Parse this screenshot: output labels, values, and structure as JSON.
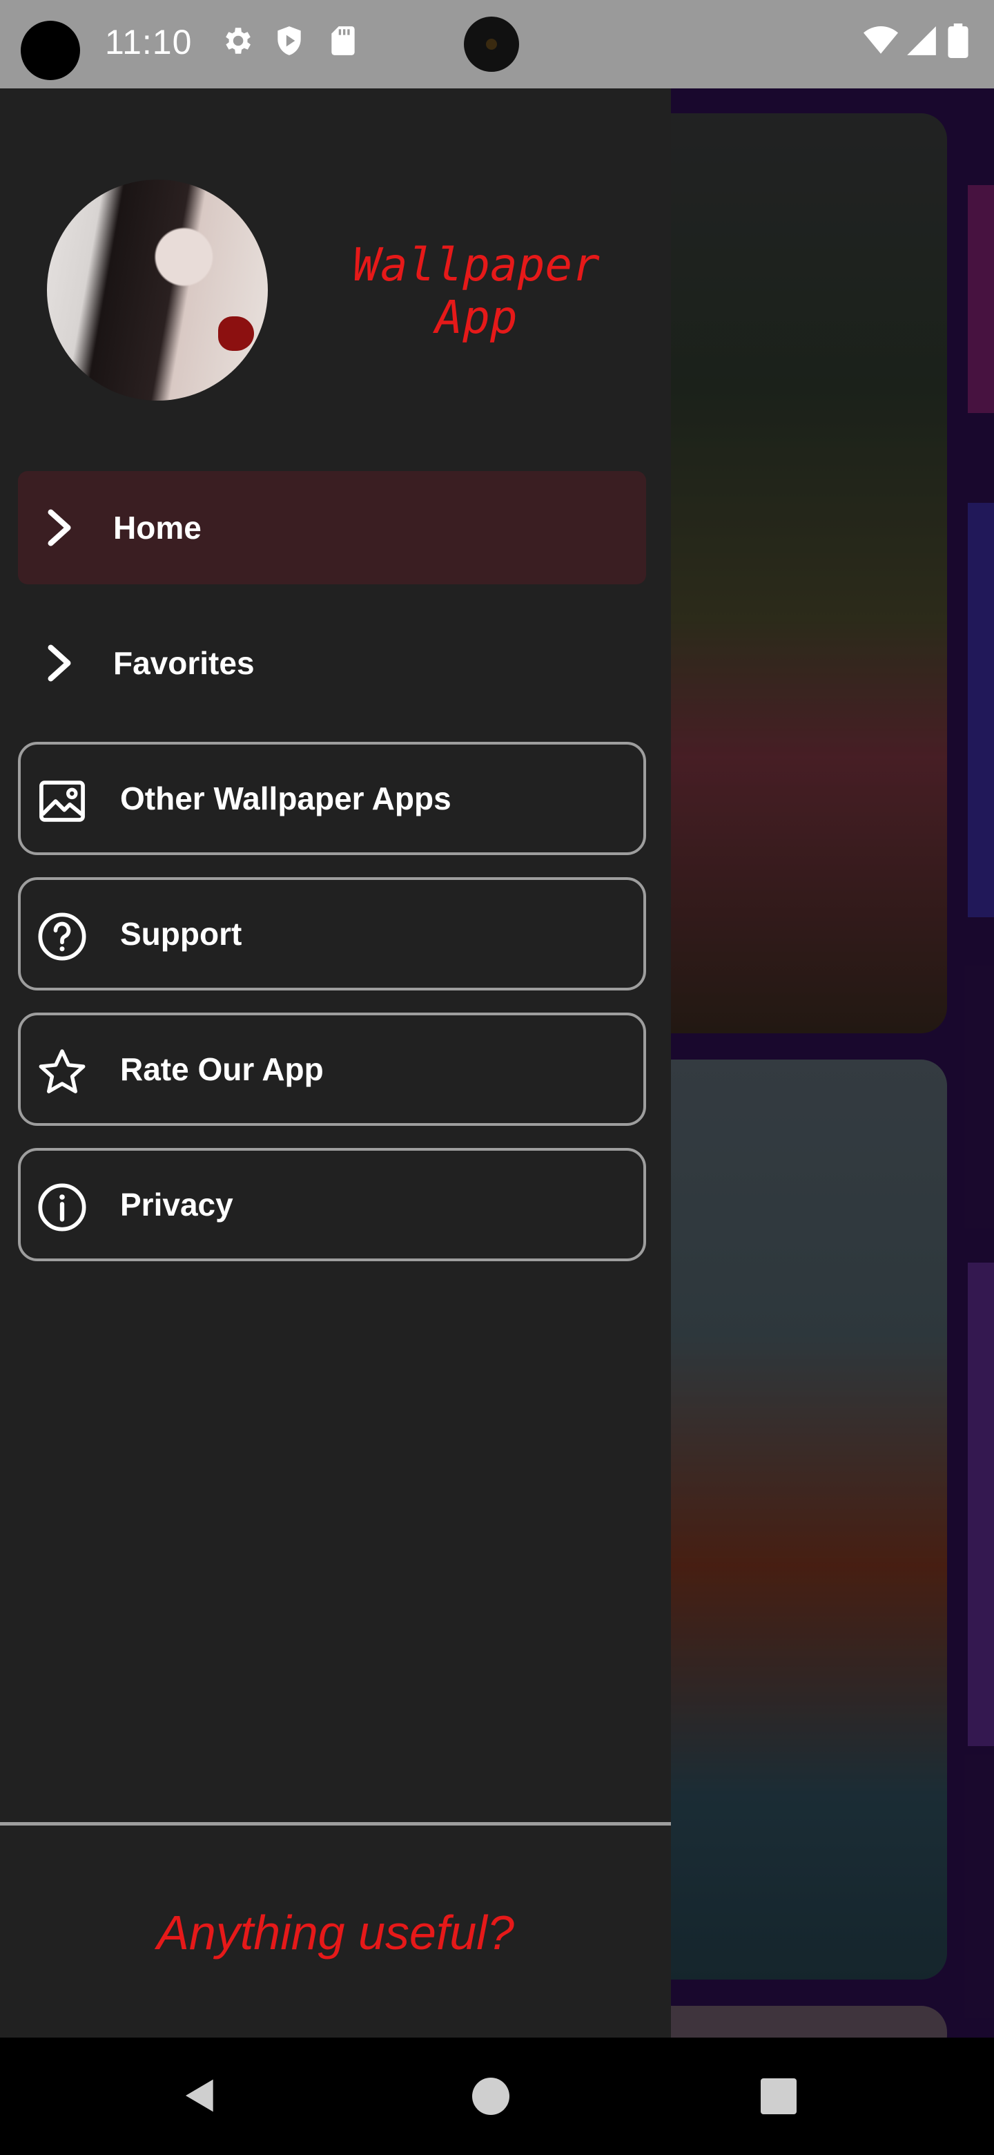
{
  "status_bar": {
    "time": "11:10",
    "icons": [
      "camera-hole",
      "gear-icon",
      "shield-icon",
      "sd-card-icon",
      "front-camera",
      "wifi-icon",
      "signal-icon",
      "battery-icon"
    ]
  },
  "drawer": {
    "app_title": "Wallpaper App",
    "menu": {
      "home_label": "Home",
      "favorites_label": "Favorites",
      "other_apps_label": "Other Wallpaper Apps",
      "support_label": "Support",
      "rate_label": "Rate Our App",
      "privacy_label": "Privacy"
    },
    "footer_text": "Anything useful?"
  },
  "colors": {
    "drawer_bg": "#212121",
    "accent_red": "#e61919",
    "selected_item_bg": "#3a1e22",
    "button_border": "#9e9e9e"
  },
  "nav_bar": {
    "icons": [
      "back-icon",
      "home-icon",
      "recents-icon"
    ]
  }
}
